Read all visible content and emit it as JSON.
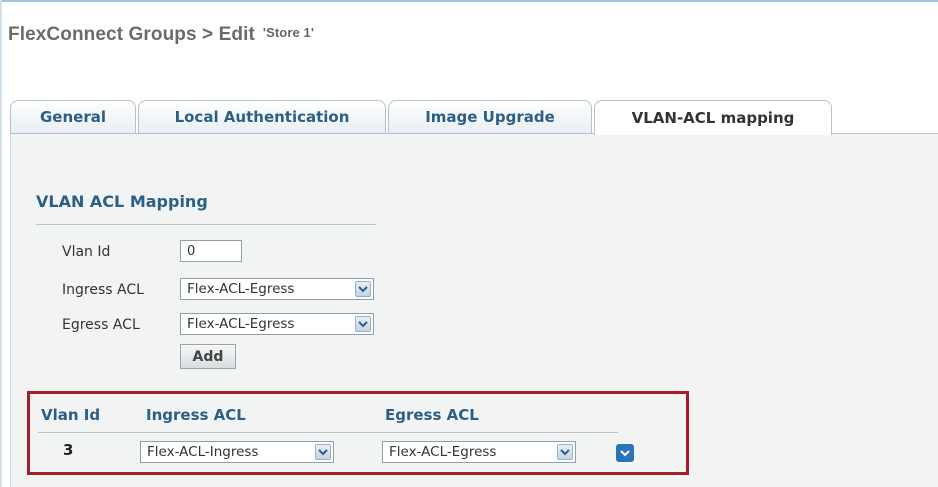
{
  "header": {
    "title": "FlexConnect Groups > Edit",
    "group_name": "'Store 1'"
  },
  "tabs": [
    {
      "label": "General",
      "active": false
    },
    {
      "label": "Local Authentication",
      "active": false
    },
    {
      "label": "Image Upgrade",
      "active": false
    },
    {
      "label": "VLAN-ACL mapping",
      "active": true
    }
  ],
  "form": {
    "section_title": "VLAN ACL Mapping",
    "vlan_id_label": "Vlan Id",
    "vlan_id_value": "0",
    "ingress_label": "Ingress ACL",
    "ingress_value": "Flex-ACL-Egress",
    "egress_label": "Egress ACL",
    "egress_value": "Flex-ACL-Egress",
    "add_button": "Add"
  },
  "table": {
    "columns": [
      "Vlan Id",
      "Ingress ACL",
      "Egress ACL"
    ],
    "rows": [
      {
        "vlan_id": "3",
        "ingress": "Flex-ACL-Ingress",
        "egress": "Flex-ACL-Egress"
      }
    ]
  },
  "colors": {
    "tab_text": "#2c5f86",
    "highlight_border": "#a71c27",
    "action_button": "#2a74b8"
  },
  "icons": {
    "select_arrow": "chevron-down-icon",
    "row_action": "row-menu-icon"
  }
}
